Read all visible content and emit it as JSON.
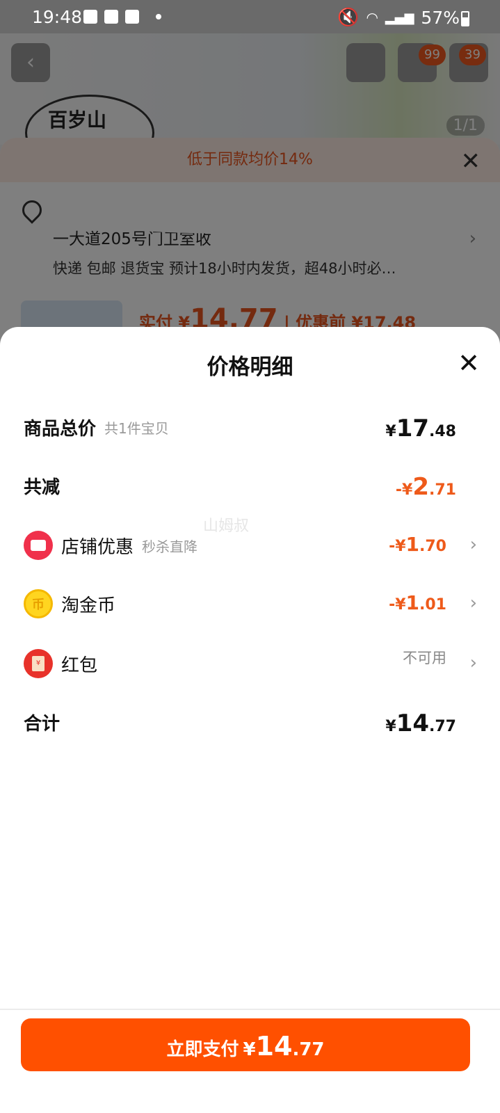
{
  "status_bar": {
    "time": "19:48",
    "battery": "57%",
    "icons": [
      "image-icon",
      "bag-icon",
      "check-icon",
      "dot-icon",
      "mute-icon",
      "wifi-icon",
      "signal-icon",
      "battery-icon"
    ]
  },
  "background": {
    "cart_badge": "99",
    "more_badge": "39",
    "image_index": "1/1",
    "logo_text": "百岁山",
    "notice": "低于同款均价14%",
    "address_line": "一大道205号门卫室收",
    "shipping": "快递 包邮 退货宝 预计18小时内发货，超48小时必…",
    "pay_prefix": "实付 ¥",
    "pay_big": "14.77",
    "pay_suffix": "| 优惠前 ¥17.48"
  },
  "modal": {
    "title": "价格明细",
    "watermark": "山姆叔",
    "rows": {
      "subtotal": {
        "label": "商品总价",
        "sub": "共1件宝贝",
        "cur": "¥",
        "int": "17",
        "dec": ".48"
      },
      "discount_total": {
        "label": "共减",
        "cur": "-¥",
        "int": "2",
        "dec": ".71"
      },
      "shop_discount": {
        "label": "店铺优惠",
        "sub": "秒杀直降",
        "cur": "-¥",
        "int": "1",
        "dec": ".70"
      },
      "gold_coin": {
        "label": "淘金币",
        "cur": "-¥",
        "int": "1",
        "dec": ".01"
      },
      "red_packet": {
        "label": "红包",
        "value": "不可用"
      },
      "total": {
        "label": "合计",
        "cur": "¥",
        "int": "14",
        "dec": ".77"
      }
    },
    "pay_button": {
      "label": "立即支付",
      "cur": "¥",
      "int": "14",
      "dec": ".77"
    }
  },
  "colors": {
    "accent": "#ff5000",
    "discount": "#ee5a1a"
  }
}
